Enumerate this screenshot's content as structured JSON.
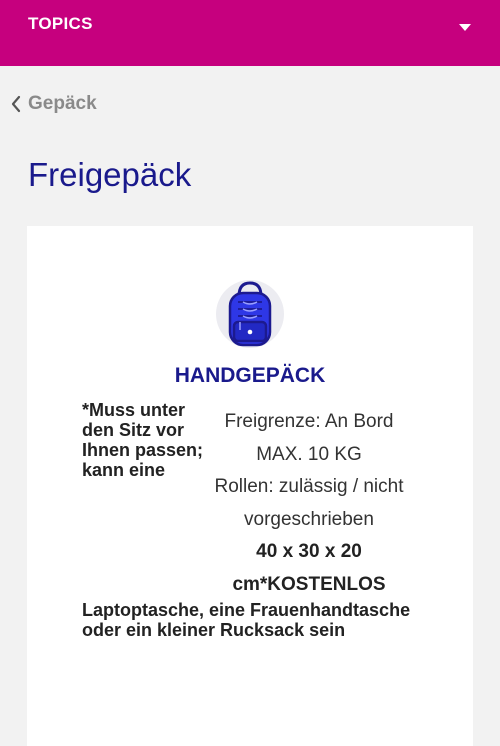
{
  "header": {
    "title": "TOPICS",
    "menu_icon": "caret-down-icon",
    "color": "#c6007e"
  },
  "breadcrumb": {
    "label": "Gepäck",
    "icon": "chevron-left-icon"
  },
  "page": {
    "title": "Freigepäck",
    "title_color": "#1a1a8c"
  },
  "card": {
    "icon": "backpack-icon",
    "heading": "HANDGEPÄCK",
    "note_left": "*Muss unter den Sitz vor Ihnen passen; kann eine",
    "lines": [
      "Freigrenze: An Bord",
      "MAX. 10 KG",
      "Rollen: zulässig / nicht",
      "vorgeschrieben"
    ],
    "bold_lines": [
      "40 x 30 x 20",
      "cm*KOSTENLOS"
    ],
    "note_bottom": "Laptoptasche, eine Frauenhandtasche oder ein kleiner Rucksack sein"
  }
}
